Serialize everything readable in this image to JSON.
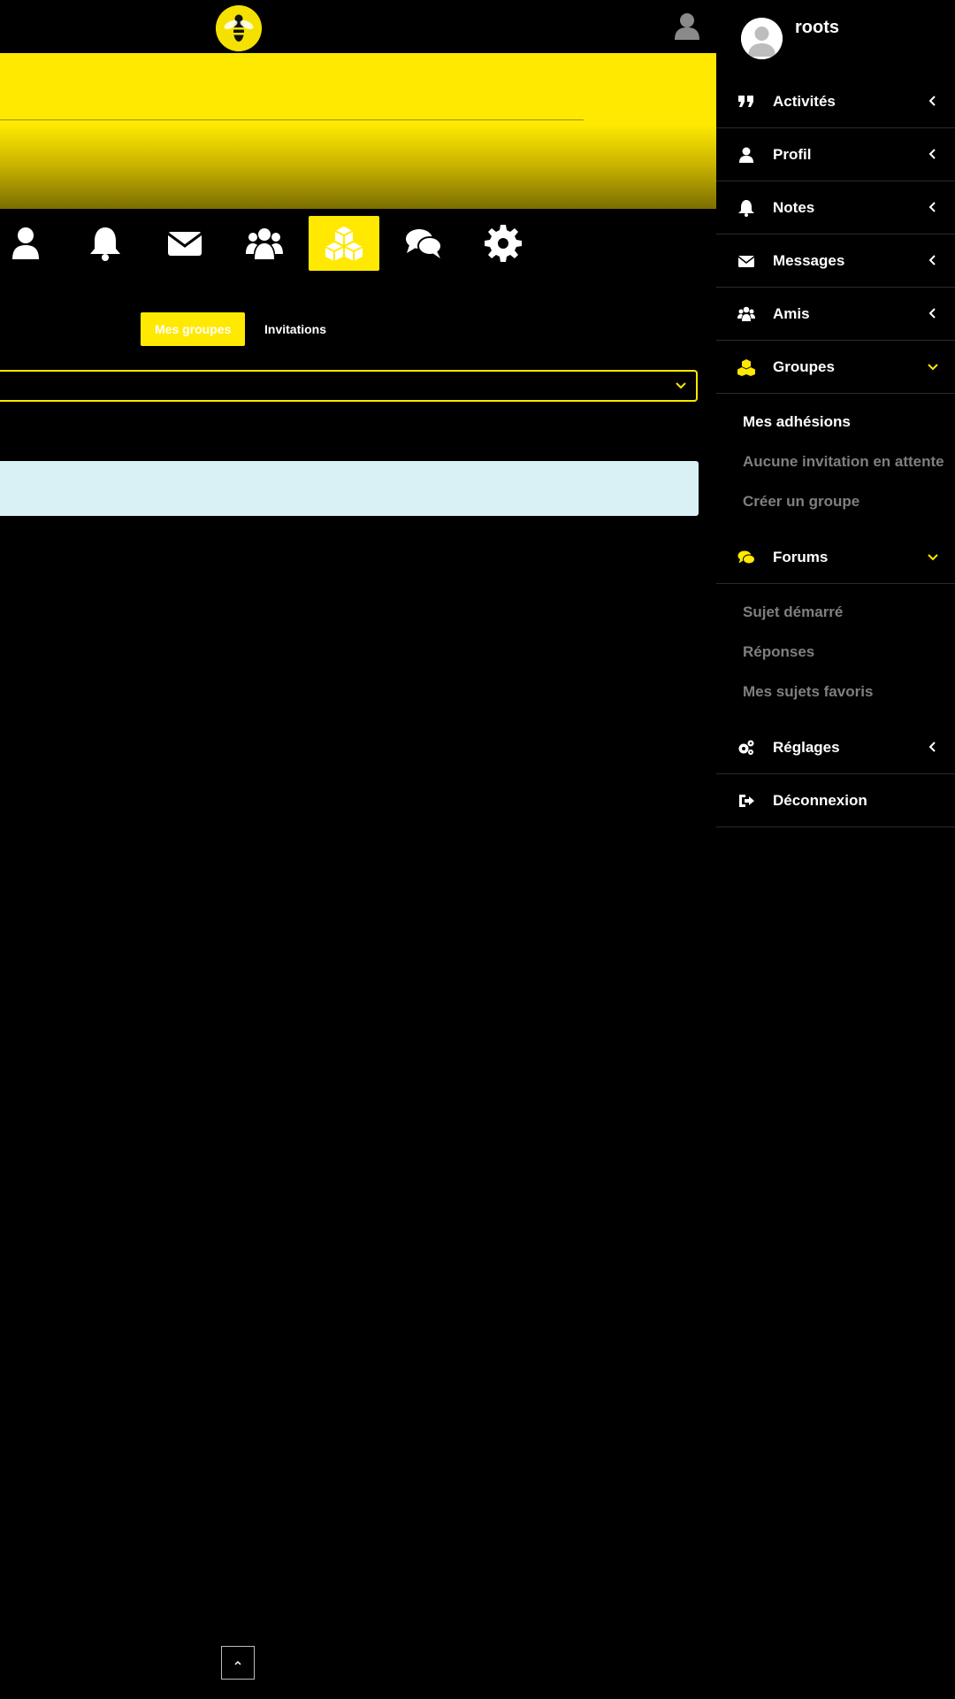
{
  "header": {
    "logo_icon": "bee-logo-icon",
    "user_icon": "user-silhouette-icon"
  },
  "profile_nav": {
    "items": [
      {
        "icon": "user-icon",
        "active": false
      },
      {
        "icon": "bell-icon",
        "active": false
      },
      {
        "icon": "envelope-icon",
        "active": false
      },
      {
        "icon": "users-icon",
        "active": false
      },
      {
        "icon": "cubes-icon",
        "active": true
      },
      {
        "icon": "comments-icon",
        "active": false
      },
      {
        "icon": "gear-icon",
        "active": false
      }
    ]
  },
  "subnav": {
    "tabs": [
      {
        "label": "Mes groupes",
        "active": true
      },
      {
        "label": "Invitations",
        "active": false
      }
    ]
  },
  "filter": {
    "value": ""
  },
  "side_panel": {
    "username": "roots",
    "menu": [
      {
        "label": "Activités",
        "icon": "quote-icon",
        "expanded": false
      },
      {
        "label": "Profil",
        "icon": "user-icon",
        "expanded": false
      },
      {
        "label": "Notes",
        "icon": "bell-icon",
        "expanded": false
      },
      {
        "label": "Messages",
        "icon": "envelope-icon",
        "expanded": false
      },
      {
        "label": "Amis",
        "icon": "users-icon",
        "expanded": false
      },
      {
        "label": "Groupes",
        "icon": "cubes-icon",
        "expanded": true,
        "sub": [
          "Mes adhésions",
          "Aucune invitation en attente",
          "Créer un groupe"
        ]
      },
      {
        "label": "Forums",
        "icon": "comments-icon",
        "expanded": true,
        "sub": [
          "Sujet démarré",
          "Réponses",
          "Mes sujets favoris"
        ]
      },
      {
        "label": "Réglages",
        "icon": "gears-icon",
        "expanded": false
      },
      {
        "label": "Déconnexion",
        "icon": "sign-out-icon",
        "expanded": false
      }
    ]
  },
  "colors": {
    "accent": "#ffe900",
    "background": "#000000",
    "info_box": "#d9f1f5",
    "muted": "#7f7f7f"
  }
}
